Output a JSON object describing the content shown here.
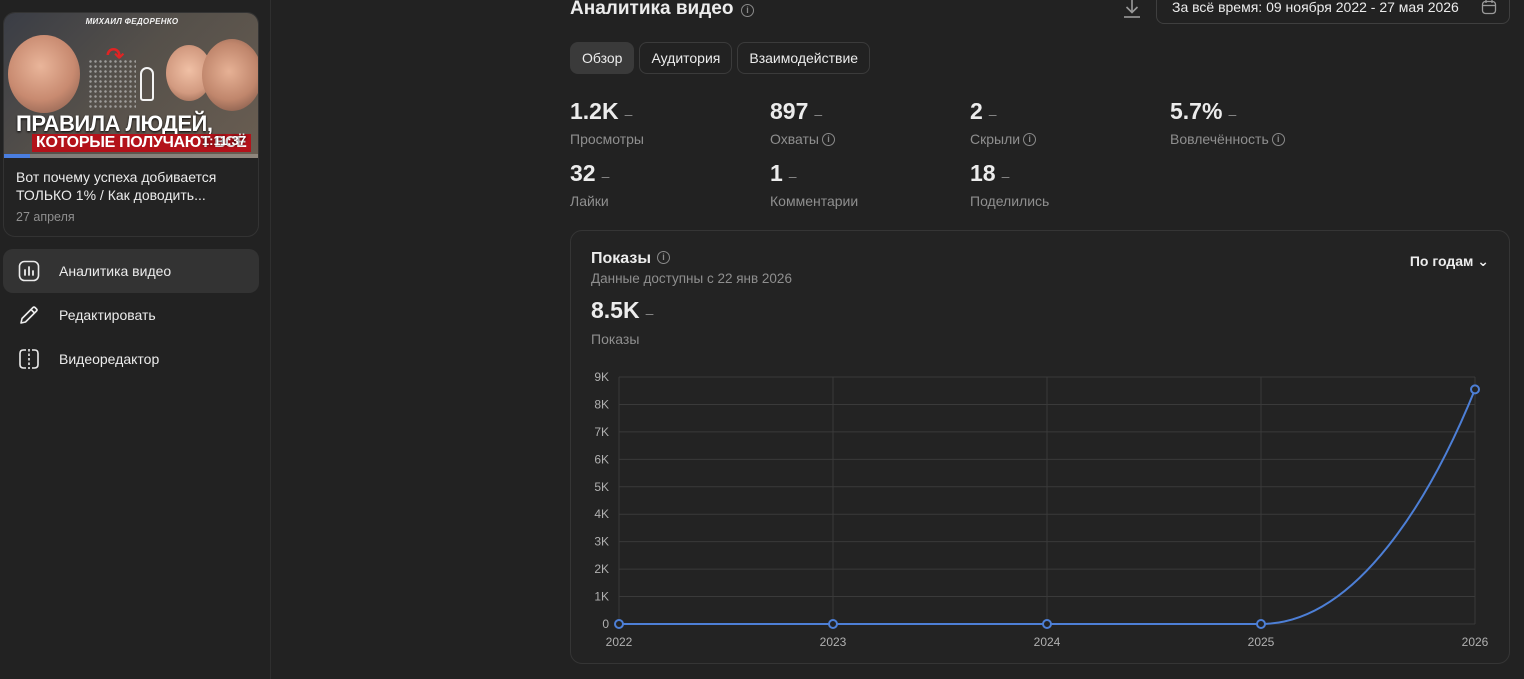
{
  "video": {
    "thumb_author": "МИХАИЛ ФЕДОРЕНКО",
    "thumb_title_line1": "ПРАВИЛА ЛЮДЕЙ,",
    "thumb_title_line2": "КОТОРЫЕ ПОЛУЧАЮТ ВСЁ",
    "duration": "1:11:37",
    "watch_progress": 0.1,
    "title": "Вот почему успеха добивается ТОЛЬКО 1% / Как доводить...",
    "date": "27 апреля"
  },
  "nav": {
    "items": [
      {
        "label": "Аналитика видео",
        "icon": "bar-chart-icon",
        "active": true
      },
      {
        "label": "Редактировать",
        "icon": "pencil-icon",
        "active": false
      },
      {
        "label": "Видеоредактор",
        "icon": "video-editor-icon",
        "active": false
      }
    ]
  },
  "header": {
    "title": "Аналитика видео",
    "date_range": "За всё время: 09 ноября 2022 - 27 мая 2026"
  },
  "tabs": [
    {
      "label": "Обзор",
      "active": true
    },
    {
      "label": "Аудитория",
      "active": false
    },
    {
      "label": "Взаимодействие",
      "active": false
    }
  ],
  "stats": [
    {
      "value": "1.2K",
      "change": "–",
      "label": "Просмотры",
      "info": false
    },
    {
      "value": "897",
      "change": "–",
      "label": "Охваты",
      "info": true
    },
    {
      "value": "2",
      "change": "–",
      "label": "Скрыли",
      "info": true
    },
    {
      "value": "5.7%",
      "change": "–",
      "label": "Вовлечённость",
      "info": true
    },
    {
      "value": "32",
      "change": "–",
      "label": "Лайки",
      "info": false
    },
    {
      "value": "1",
      "change": "–",
      "label": "Комментарии",
      "info": false
    },
    {
      "value": "18",
      "change": "–",
      "label": "Поделились",
      "info": false
    }
  ],
  "chart": {
    "title": "Показы",
    "subtitle": "Данные доступны с 22 янв 2026",
    "period": "По годам",
    "total": "8.5K",
    "total_change": "–",
    "total_label": "Показы"
  },
  "chart_data": {
    "type": "line",
    "x": [
      "2022",
      "2023",
      "2024",
      "2025",
      "2026"
    ],
    "series": [
      {
        "values": [
          0,
          0,
          0,
          0,
          8550
        ]
      }
    ],
    "ylim": [
      0,
      9000
    ],
    "yticks": [
      "0",
      "1K",
      "2K",
      "3K",
      "4K",
      "5K",
      "6K",
      "7K",
      "8K",
      "9K"
    ],
    "grid": true,
    "line_color": "#4d7fd6"
  }
}
